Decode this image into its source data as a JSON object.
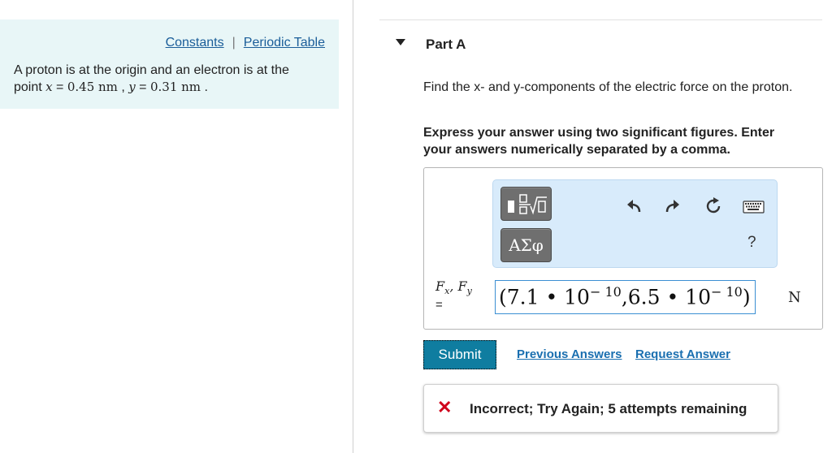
{
  "left": {
    "links": {
      "constants": "Constants",
      "separator": "|",
      "periodic_table": "Periodic Table"
    },
    "problem": {
      "text_1": "A proton is at the origin and an electron is at the",
      "text_2": "point ",
      "x_var": "x",
      "x_val": "0.45 nm",
      "y_var": "y",
      "y_val": "0.31 nm",
      "eq": " = ",
      "comma": " , ",
      "period": " ."
    }
  },
  "part": {
    "title": "Part A"
  },
  "question": "Find the x- and y-components of the electric force on the proton.",
  "instructions": "Express your answer using two significant figures. Enter your answers numerically separated by a comma.",
  "toolbar": {
    "templates_icon": "templates-icon",
    "greek_label": "ΑΣφ",
    "undo_icon": "undo-icon",
    "redo_icon": "redo-icon",
    "reset_icon": "reset-icon",
    "keyboard_icon": "keyboard-icon",
    "help_label": "?"
  },
  "answer": {
    "variable": "Fx, Fy",
    "equals": "=",
    "value": {
      "open": "(7.1 • 10",
      "exp1": "− 10",
      "mid": ",6.5 • 10",
      "exp2": "− 10",
      "close": ")"
    },
    "units": "N"
  },
  "buttons": {
    "submit": "Submit",
    "previous_answers": "Previous Answers",
    "request_answer": "Request Answer"
  },
  "feedback": {
    "icon": "error-x-icon",
    "text": "Incorrect; Try Again; 5 attempts remaining"
  },
  "colors": {
    "left_panel_bg": "#e8f6f7",
    "link": "#1a5d99",
    "submit_bg": "#0f7da0",
    "toolbar_bg": "#d8ebfb",
    "error_red": "#d0021b"
  }
}
